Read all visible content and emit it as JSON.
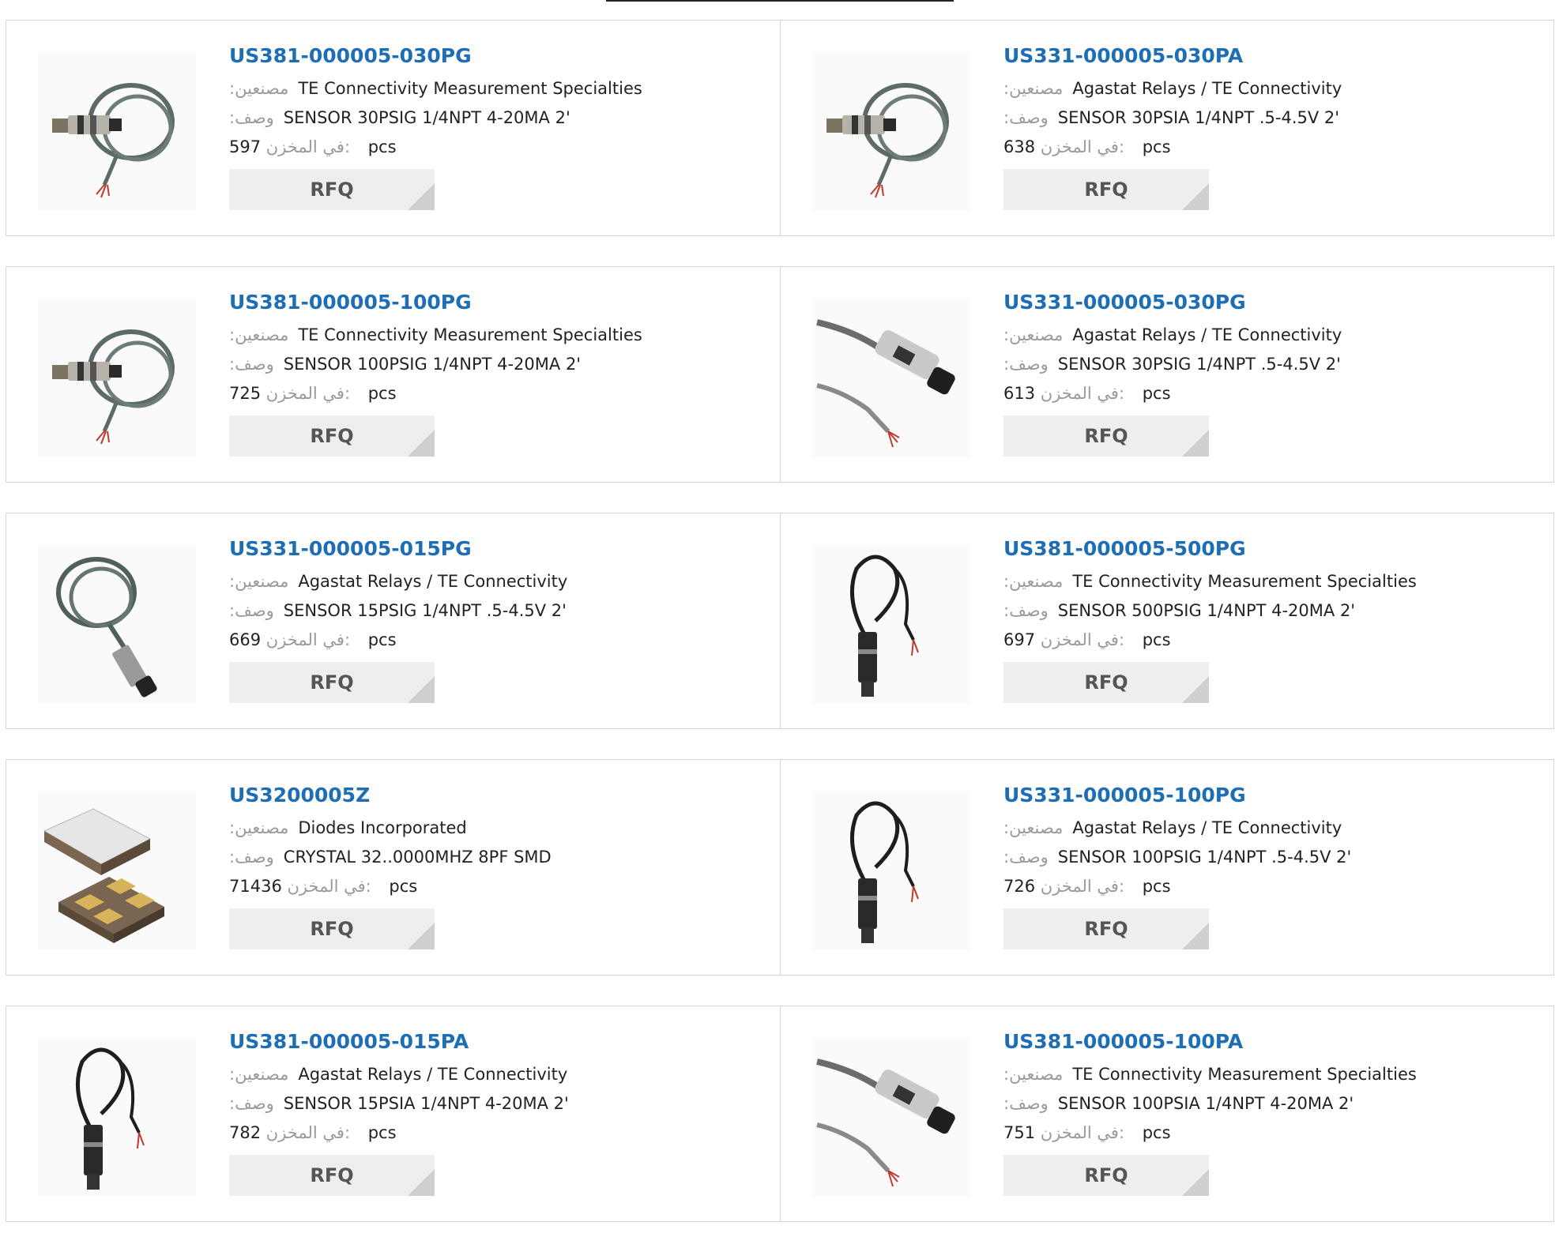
{
  "labels": {
    "manufacturer": ":مصنعين",
    "description": ":وصف",
    "in_stock": "في المخزن:",
    "unit": "pcs",
    "rfq": "RFQ"
  },
  "products": [
    {
      "part": "US381-000005-030PG",
      "manufacturer": "TE Connectivity Measurement Specialties",
      "description": "SENSOR 30PSIG 1/4NPT 4-20MA 2'",
      "stock": "597",
      "image": "coiled-cable-sensor"
    },
    {
      "part": "US331-000005-030PA",
      "manufacturer": "Agastat Relays / TE Connectivity",
      "description": "SENSOR 30PSIA 1/4NPT .5-4.5V 2'",
      "stock": "638",
      "image": "coiled-cable-sensor"
    },
    {
      "part": "US381-000005-100PG",
      "manufacturer": "TE Connectivity Measurement Specialties",
      "description": "SENSOR 100PSIG 1/4NPT 4-20MA 2'",
      "stock": "725",
      "image": "coiled-cable-sensor"
    },
    {
      "part": "US331-000005-030PG",
      "manufacturer": "Agastat Relays / TE Connectivity",
      "description": "SENSOR 30PSIG 1/4NPT .5-4.5V 2'",
      "stock": "613",
      "image": "straight-cable-sensor"
    },
    {
      "part": "US331-000005-015PG",
      "manufacturer": "Agastat Relays / TE Connectivity",
      "description": "SENSOR 15PSIG 1/4NPT .5-4.5V 2'",
      "stock": "669",
      "image": "diagonal-sensor"
    },
    {
      "part": "US381-000005-500PG",
      "manufacturer": "TE Connectivity Measurement Specialties",
      "description": "SENSOR 500PSIG 1/4NPT 4-20MA 2'",
      "stock": "697",
      "image": "vertical-sensor"
    },
    {
      "part": "US3200005Z",
      "manufacturer": "Diodes Incorporated",
      "description": "CRYSTAL 32..0000MHZ 8PF SMD",
      "stock": "71436",
      "image": "crystal-package"
    },
    {
      "part": "US331-000005-100PG",
      "manufacturer": "Agastat Relays / TE Connectivity",
      "description": "SENSOR 100PSIG 1/4NPT .5-4.5V 2'",
      "stock": "726",
      "image": "vertical-sensor"
    },
    {
      "part": "US381-000005-015PA",
      "manufacturer": "Agastat Relays / TE Connectivity",
      "description": "SENSOR 15PSIA 1/4NPT 4-20MA 2'",
      "stock": "782",
      "image": "vertical-sensor"
    },
    {
      "part": "US381-000005-100PA",
      "manufacturer": "TE Connectivity Measurement Specialties",
      "description": "SENSOR 100PSIA 1/4NPT 4-20MA 2'",
      "stock": "751",
      "image": "straight-cable-sensor"
    }
  ]
}
